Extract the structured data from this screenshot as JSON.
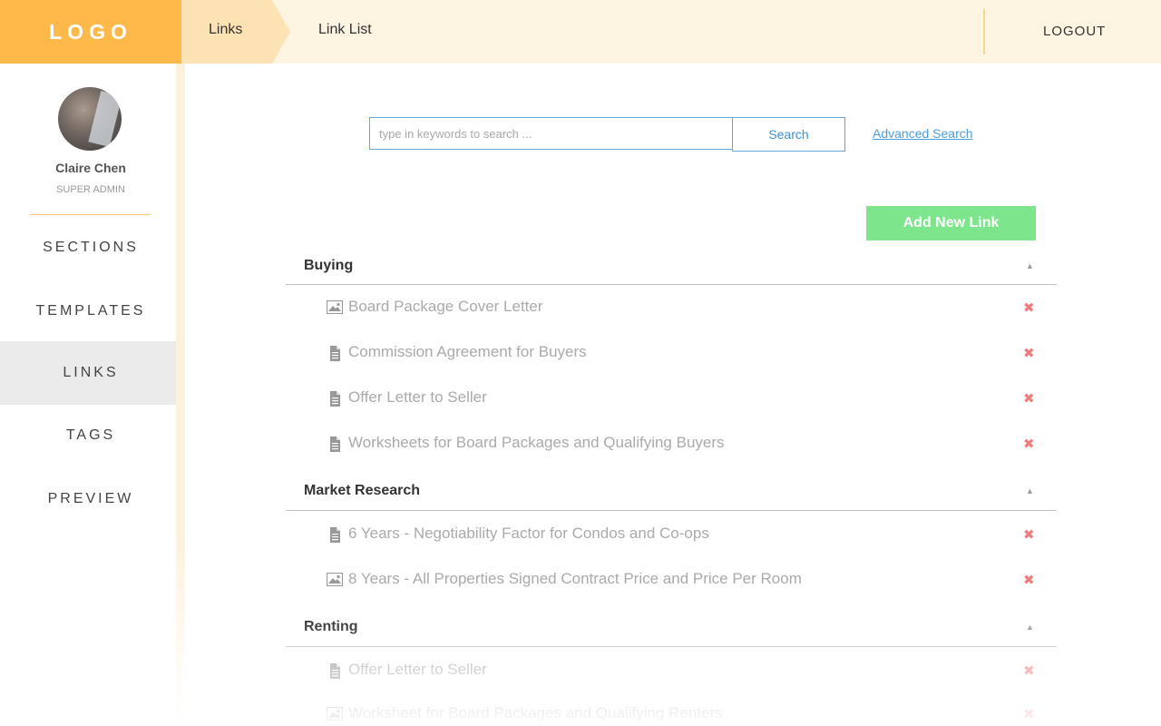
{
  "header": {
    "logo": "LOGO",
    "breadcrumb": [
      "Links",
      "Link List"
    ],
    "logout": "LOGOUT",
    "colors": {
      "logo_bg": "#feb94a",
      "bar_bg": "#fef4e2"
    }
  },
  "sidebar": {
    "user": {
      "name": "Claire Chen",
      "role": "SUPER ADMIN"
    },
    "items": [
      {
        "label": "SECTIONS",
        "active": false
      },
      {
        "label": "TEMPLATES",
        "active": false
      },
      {
        "label": "LINKS",
        "active": true
      },
      {
        "label": "TAGS",
        "active": false
      },
      {
        "label": "PREVIEW",
        "active": false
      }
    ]
  },
  "search": {
    "placeholder": "type in keywords to search ...",
    "value": "",
    "button": "Search",
    "advanced": "Advanced Search"
  },
  "actions": {
    "add_new": "Add New Link"
  },
  "sections": [
    {
      "title": "Buying",
      "items": [
        {
          "label": "Board Package Cover Letter",
          "icon": "image-icon"
        },
        {
          "label": "Commission Agreement for Buyers",
          "icon": "document-icon"
        },
        {
          "label": "Offer Letter to Seller",
          "icon": "document-icon"
        },
        {
          "label": "Worksheets for Board Packages and Qualifying Buyers",
          "icon": "document-icon"
        }
      ]
    },
    {
      "title": "Market Research",
      "items": [
        {
          "label": "6 Years - Negotiability Factor for Condos and Co-ops",
          "icon": "document-icon"
        },
        {
          "label": "8 Years - All Properties Signed Contract Price and Price Per Room",
          "icon": "image-icon"
        }
      ]
    },
    {
      "title": "Renting",
      "items": [
        {
          "label": "Offer Letter to Seller",
          "icon": "document-icon"
        },
        {
          "label": "Worksheet for Board Packages and Qualifying Renters",
          "icon": "image-icon"
        }
      ]
    }
  ]
}
